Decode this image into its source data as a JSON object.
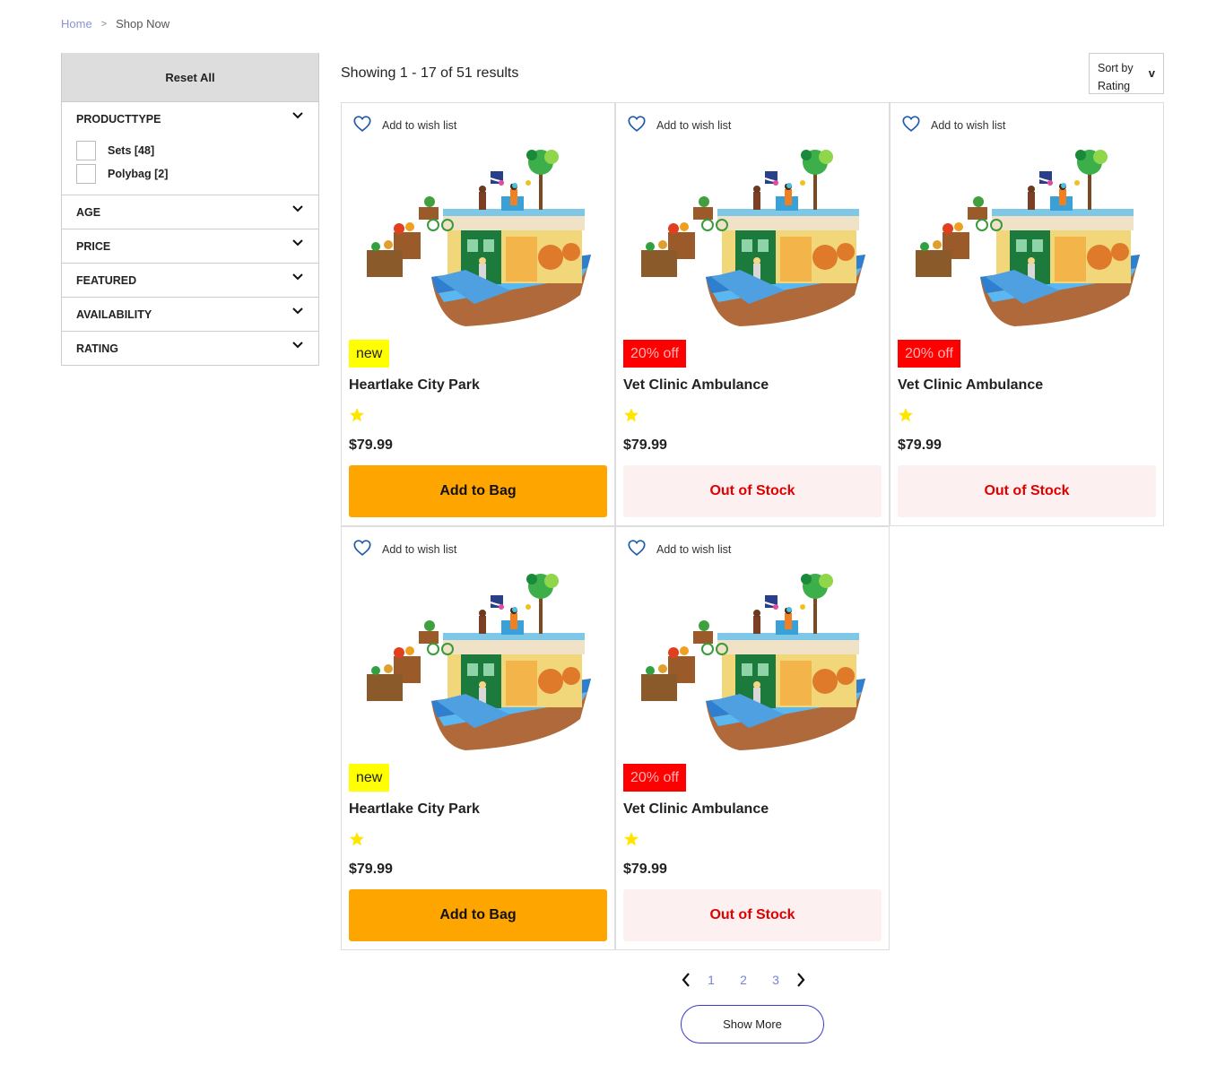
{
  "breadcrumb": {
    "home": "Home",
    "separator": ">",
    "current": "Shop Now"
  },
  "sidebar": {
    "reset_label": "Reset All",
    "filters": [
      {
        "label": "PRODUCTTYPE",
        "expanded": true,
        "options": [
          {
            "label": "Sets [48]",
            "checked": false
          },
          {
            "label": "Polybag [2]",
            "checked": false
          }
        ]
      },
      {
        "label": "AGE",
        "expanded": false
      },
      {
        "label": "PRICE",
        "expanded": false
      },
      {
        "label": "FEATURED",
        "expanded": false
      },
      {
        "label": "AVAILABILITY",
        "expanded": false
      },
      {
        "label": "RATING",
        "expanded": false
      }
    ]
  },
  "results": {
    "text": "Showing 1 - 17 of 51 results"
  },
  "sort": {
    "line1": "Sort by",
    "line2": "Rating",
    "caret": "v"
  },
  "products": [
    {
      "wish_label": "Add to wish list",
      "badge": "new",
      "badge_type": "new",
      "name": "Heartlake City Park",
      "rating_icon": "star-icon",
      "price": "$79.99",
      "action": "Add to Bag",
      "action_type": "add"
    },
    {
      "wish_label": "Add to wish list",
      "badge": "20% off",
      "badge_type": "off",
      "name": "Vet Clinic Ambulance",
      "rating_icon": "star-icon",
      "price": "$79.99",
      "action": "Out of Stock",
      "action_type": "oos"
    },
    {
      "wish_label": "Add to wish list",
      "badge": "20% off",
      "badge_type": "off",
      "name": "Vet Clinic Ambulance",
      "rating_icon": "star-icon",
      "price": "$79.99",
      "action": "Out of Stock",
      "action_type": "oos"
    },
    {
      "wish_label": "Add to wish list",
      "badge": "new",
      "badge_type": "new",
      "name": "Heartlake City Park",
      "rating_icon": "star-icon",
      "price": "$79.99",
      "action": "Add to Bag",
      "action_type": "add"
    },
    {
      "wish_label": "Add to wish list",
      "badge": "20% off",
      "badge_type": "off",
      "name": "Vet Clinic Ambulance",
      "rating_icon": "star-icon",
      "price": "$79.99",
      "action": "Out of Stock",
      "action_type": "oos"
    }
  ],
  "pagination": {
    "pages": [
      "1",
      "2",
      "3"
    ]
  },
  "show_more": "Show More",
  "colors": {
    "add_bg": "#ffa500",
    "oos_bg": "#fdf0f0",
    "oos_text": "#e00000",
    "badge_new": "#ffff00",
    "badge_off": "#ff0000",
    "link": "#8a94d6",
    "show_more_border": "#3a3ad0"
  }
}
